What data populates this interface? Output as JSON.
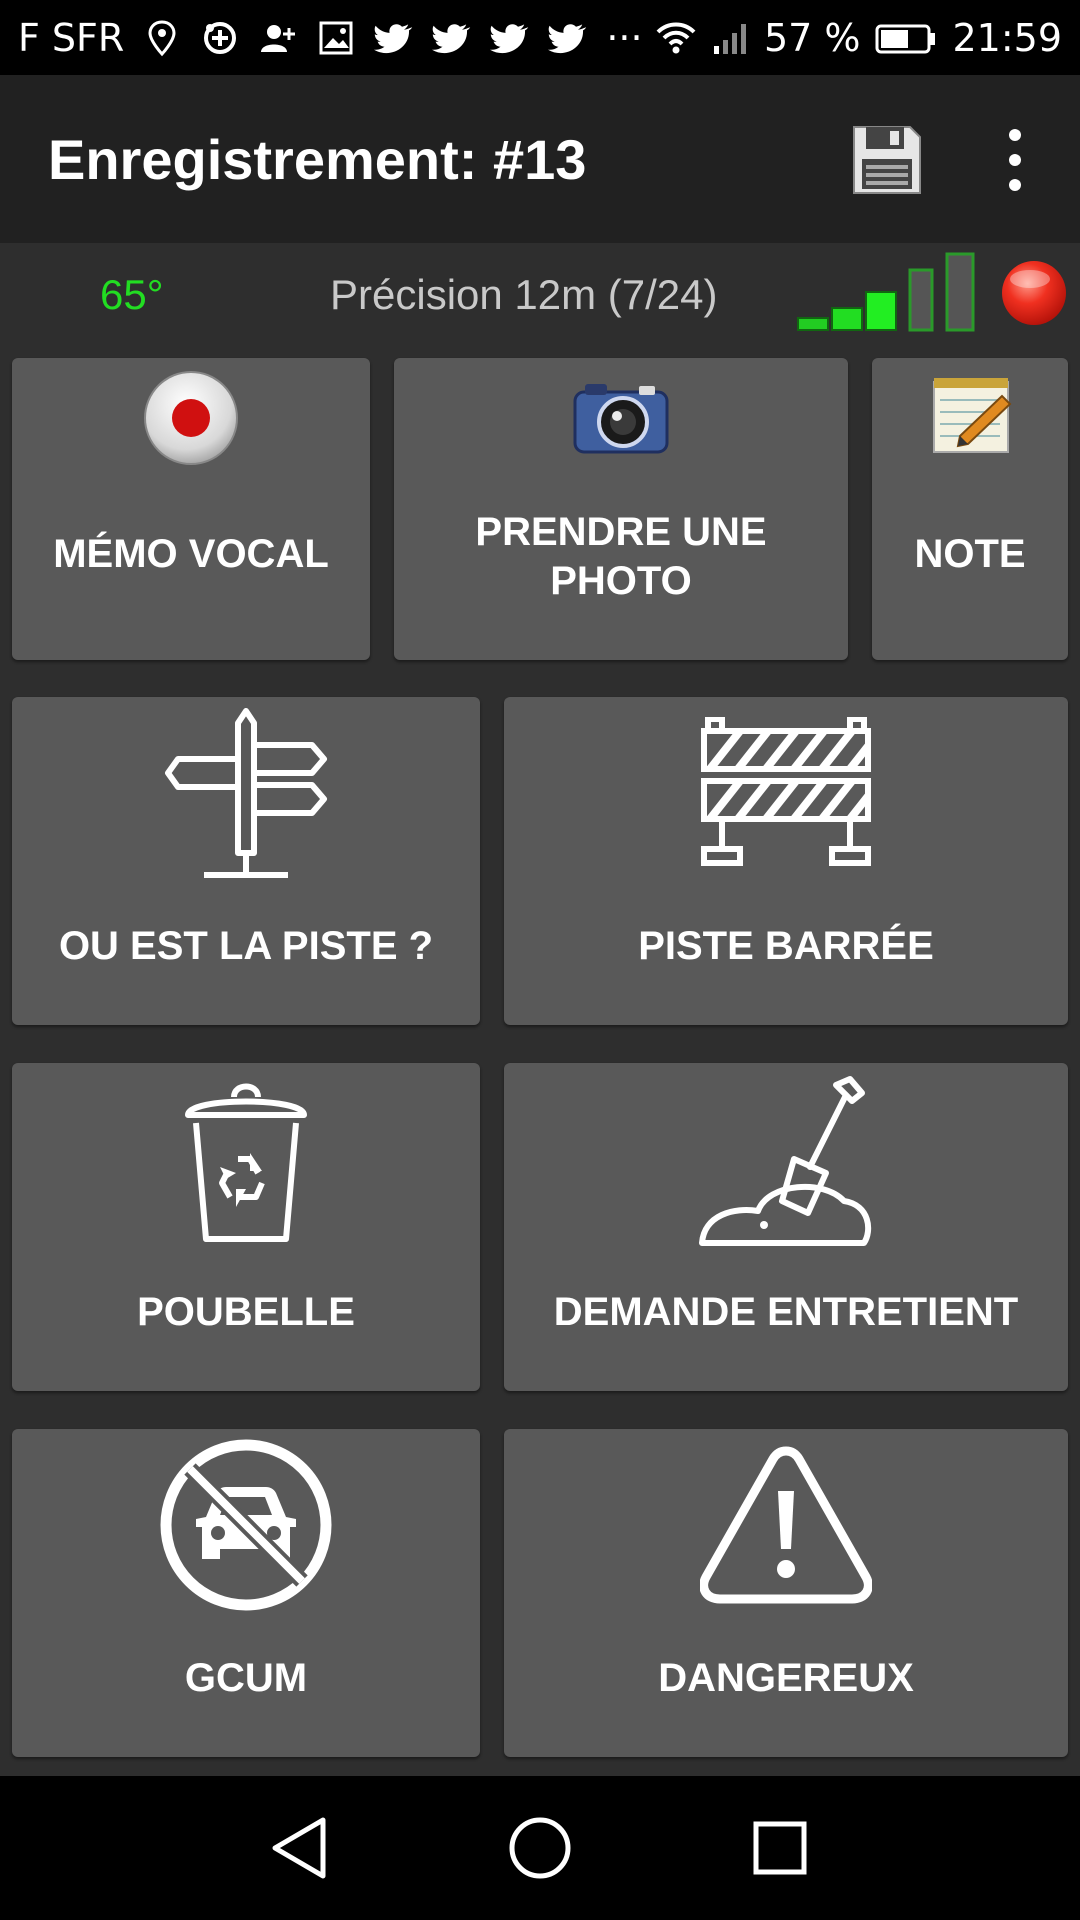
{
  "status_bar": {
    "carrier": "F SFR",
    "overflow": "···",
    "battery": "57 %",
    "time": "21:59",
    "icons": [
      "location-icon",
      "app-icon",
      "add-contact-icon",
      "gallery-icon",
      "twitter-icon",
      "twitter-icon",
      "twitter-icon",
      "twitter-icon",
      "wifi-icon",
      "cell-signal-icon",
      "battery-icon"
    ]
  },
  "toolbar": {
    "title": "Enregistrement: #13",
    "save_icon": "floppy-disk-icon",
    "menu_icon": "more-vert-icon"
  },
  "info": {
    "heading": "65°",
    "precision": "Précision 12m (7/24)",
    "signal_icon": "gps-signal-bars-icon",
    "signal_level": 0.6,
    "recording_icon": "recording-dot-icon"
  },
  "tiles": [
    {
      "label": "MÉMO VOCAL",
      "icon": "record-button-icon"
    },
    {
      "label": "PRENDRE UNE PHOTO",
      "icon": "camera-icon"
    },
    {
      "label": "NOTE",
      "icon": "notepad-pencil-icon"
    },
    {
      "label": "OU EST LA PISTE ?",
      "icon": "signpost-icon"
    },
    {
      "label": "PISTE BARRÉE",
      "icon": "barrier-icon"
    },
    {
      "label": "POUBELLE",
      "icon": "recycle-bin-icon"
    },
    {
      "label": "DEMANDE ENTRETIENT",
      "icon": "shovel-icon"
    },
    {
      "label": "GCUM",
      "icon": "no-car-icon"
    },
    {
      "label": "DANGEREUX",
      "icon": "warning-icon"
    }
  ],
  "nav": {
    "back_icon": "back-triangle-icon",
    "home_icon": "home-circle-icon",
    "recents_icon": "recents-square-icon"
  },
  "colors": {
    "heading": "#22dd22",
    "tile_bg": "#595959",
    "screen_bg": "#2e2e2e",
    "toolbar_bg": "#212121"
  }
}
